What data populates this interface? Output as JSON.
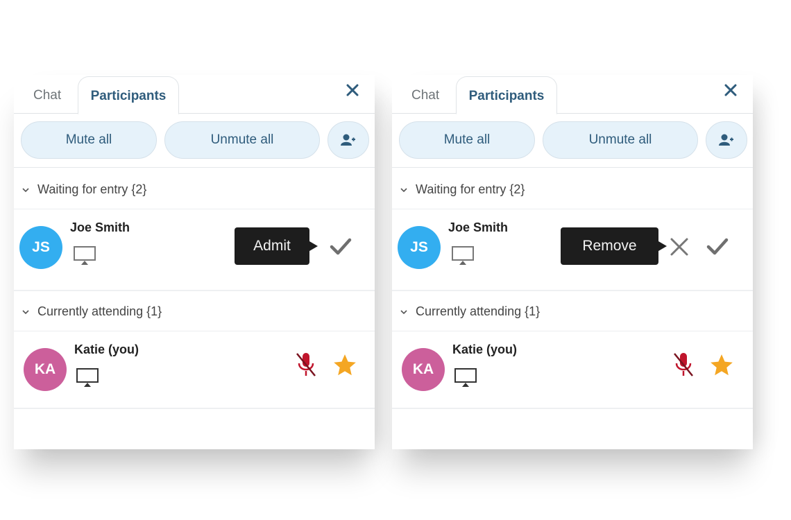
{
  "colors": {
    "accent": "#2f5c7c",
    "pill_bg": "#e6f2fa",
    "avatar_js": "#33aef0",
    "avatar_ka": "#cc5f9b",
    "muted_mic": "#c0152c",
    "star": "#f4a623",
    "tooltip_bg": "#1d1d1d"
  },
  "panels": [
    {
      "tabs": [
        {
          "label": "Chat",
          "active": false
        },
        {
          "label": "Participants",
          "active": true
        }
      ],
      "close_icon": "close-icon",
      "actions": {
        "mute_all": "Mute all",
        "unmute_all": "Unmute all",
        "add_user_icon": "add-user-icon"
      },
      "sections": [
        {
          "title": "Waiting for entry {2}",
          "participants": [
            {
              "initials": "JS",
              "name": "Joe Smith",
              "device_icon": "monitor-icon",
              "tooltip": "Admit",
              "actions": [
                "check-icon"
              ]
            }
          ]
        },
        {
          "title": "Currently attending {1}",
          "participants": [
            {
              "initials": "KA",
              "name": "Katie (you)",
              "device_icon": "monitor-icon",
              "status_icons": [
                "muted-mic-icon",
                "star-icon"
              ]
            }
          ]
        }
      ]
    },
    {
      "tabs": [
        {
          "label": "Chat",
          "active": false
        },
        {
          "label": "Participants",
          "active": true
        }
      ],
      "close_icon": "close-icon",
      "actions": {
        "mute_all": "Mute all",
        "unmute_all": "Unmute all",
        "add_user_icon": "add-user-icon"
      },
      "sections": [
        {
          "title": "Waiting for entry {2}",
          "participants": [
            {
              "initials": "JS",
              "name": "Joe Smith",
              "device_icon": "monitor-icon",
              "tooltip": "Remove",
              "actions": [
                "x-icon",
                "check-icon"
              ]
            }
          ]
        },
        {
          "title": "Currently attending {1}",
          "participants": [
            {
              "initials": "KA",
              "name": "Katie (you)",
              "device_icon": "monitor-icon",
              "status_icons": [
                "muted-mic-icon",
                "star-icon"
              ]
            }
          ]
        }
      ]
    }
  ]
}
